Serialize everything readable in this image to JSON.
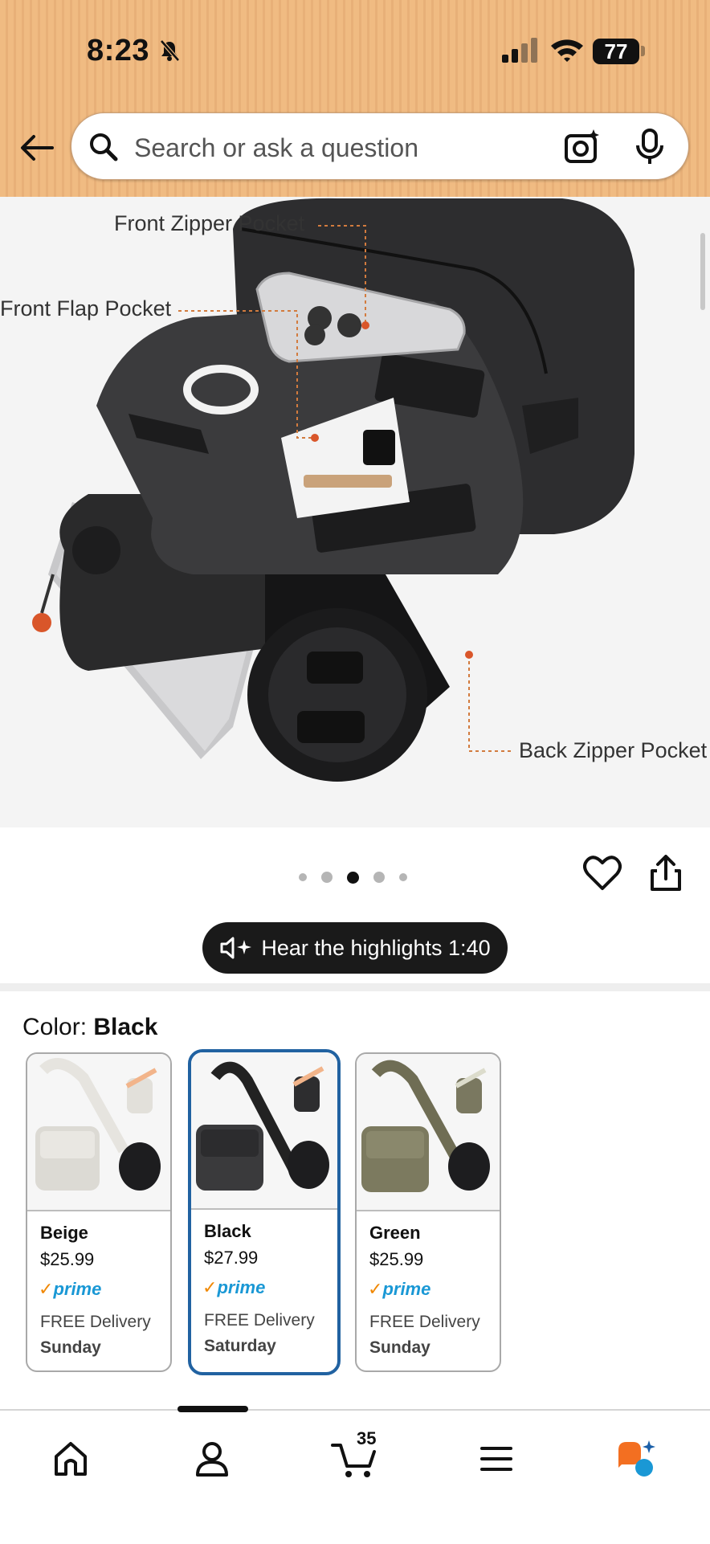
{
  "status_bar": {
    "time": "8:23",
    "battery": "77"
  },
  "search": {
    "placeholder": "Search or ask a question"
  },
  "product_image": {
    "callouts": {
      "front_zipper": "Front Zipper Pocket",
      "front_flap": "Front Flap Pocket",
      "back_zipper": "Back Zipper Pocket"
    },
    "carousel": {
      "total": 5,
      "active_index": 2
    }
  },
  "hear_highlights": {
    "label": "Hear the highlights 1:40"
  },
  "color": {
    "label": "Color: ",
    "selected": "Black",
    "options": [
      {
        "name": "Beige",
        "price": "$25.99",
        "prime": "prime",
        "delivery": "FREE Delivery",
        "day": "Sunday",
        "bag_color": "#dcdad4",
        "selected": false
      },
      {
        "name": "Black",
        "price": "$27.99",
        "prime": "prime",
        "delivery": "FREE Delivery",
        "day": "Saturday",
        "bag_color": "#3a3a3c",
        "selected": true
      },
      {
        "name": "Green",
        "price": "$25.99",
        "prime": "prime",
        "delivery": "FREE Delivery",
        "day": "Sunday",
        "bag_color": "#7c7a5f",
        "selected": false
      }
    ]
  },
  "bottom_nav": {
    "cart_count": "35",
    "items": [
      "home-icon",
      "account-icon",
      "cart-icon",
      "menu-icon",
      "rufus-assistant-icon"
    ]
  },
  "colors": {
    "header": "#f0bb82",
    "selected_border": "#2162a1",
    "prime_blue": "#1a98d5",
    "prime_check": "#f08804"
  }
}
